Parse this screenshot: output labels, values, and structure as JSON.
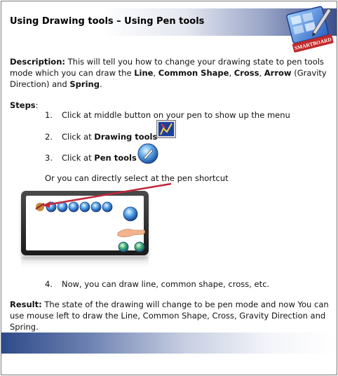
{
  "header": {
    "title": "Using Drawing tools – Using Pen tools",
    "logo_text": "SMARTBOARD",
    "logo_icon": "smartboard-pen-logo"
  },
  "description": {
    "label": "Description:",
    "text1": " This will tell you how to change your drawing state to pen tools mode which you can draw the ",
    "line": "Line",
    "sep1": ", ",
    "common_shape": "Common Shape",
    "sep2": ", ",
    "cross": "Cross",
    "sep3": ", ",
    "arrow": "Arrow",
    "text2": " (Gravity Direction) and ",
    "spring": "Spring",
    "end": "."
  },
  "steps": {
    "heading": "Steps",
    "heading_colon": ":",
    "items": [
      {
        "num": "1.",
        "text": "Click at middle button on your pen to show up the menu"
      },
      {
        "num": "2.",
        "prefix": "Click at ",
        "bold": "Drawing tools",
        "icon": "drawing-tools-icon"
      },
      {
        "num": "3.",
        "prefix": "Click at ",
        "bold": "Pen tools",
        "icon": "pen-tools-icon"
      },
      {
        "num": "4.",
        "text": "Now, you can draw line, common shape, cross, etc."
      }
    ],
    "note": "Or you can directly select at the pen shortcut"
  },
  "result": {
    "label": "Result:",
    "text": " The state of the drawing will change to be pen mode and now You can use mouse left to draw the Line, Common Shape, Cross, Gravity Direction and Spring."
  },
  "colors": {
    "header_gradient_end": "#3b4f8c",
    "footer_gradient_start": "#2e4a8a",
    "arrow": "#c0273a"
  }
}
